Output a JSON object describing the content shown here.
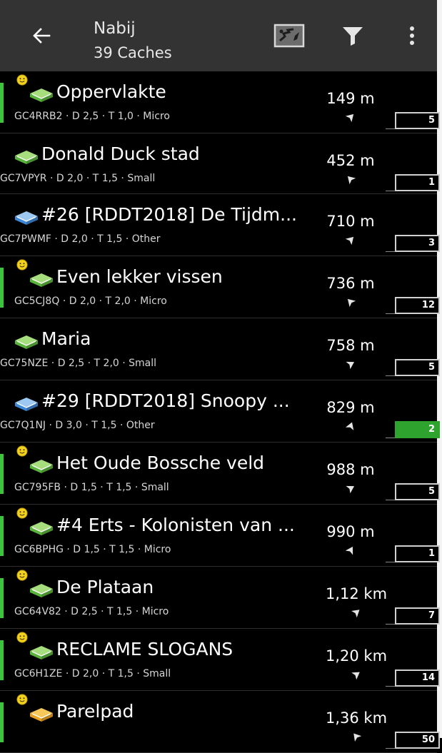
{
  "toolbar": {
    "title": "Nabij",
    "subtitle": "39 Caches"
  },
  "icons": {
    "back": "arrow-left-icon",
    "map": "map-icon",
    "filter": "filter-icon",
    "more": "more-vert-icon"
  },
  "colors": {
    "toolbar": "#333333",
    "found_bar": "#3cc43c",
    "highlight_count": "#2ea42e"
  },
  "caches": [
    {
      "name": "Oppervlakte",
      "meta": "GC4RRB2 · D 2,5 · T 1,0 · Micro",
      "distance": "149 m",
      "count": "5",
      "icon": "traditional-cache-icon",
      "smiley": true,
      "bar": true,
      "highlight": false,
      "bearing": 225
    },
    {
      "name": "Donald Duck stad",
      "meta": "GC7VPYR · D 2,0 · T 1,5 · Small",
      "distance": "452 m",
      "count": "1",
      "icon": "traditional-cache-icon",
      "smiley": false,
      "bar": false,
      "highlight": false,
      "bearing": 135
    },
    {
      "name": "#26 [RDDT2018] De Tijdm...",
      "meta": "GC7PWMF · D 2,0 · T 1,5 · Other",
      "distance": "710 m",
      "count": "3",
      "icon": "other-cache-icon",
      "smiley": false,
      "bar": false,
      "highlight": false,
      "bearing": 225
    },
    {
      "name": "Even lekker vissen",
      "meta": "GC5CJ8Q · D 2,0 · T 2,0 · Micro",
      "distance": "736 m",
      "count": "12",
      "icon": "traditional-cache-icon",
      "smiley": true,
      "bar": true,
      "highlight": false,
      "bearing": 135
    },
    {
      "name": "Maria",
      "meta": "GC75NZE · D 2,5 · T 2,0 · Small",
      "distance": "758 m",
      "count": "5",
      "icon": "traditional-cache-icon",
      "smiley": false,
      "bar": false,
      "highlight": false,
      "bearing": 240
    },
    {
      "name": "#29 [RDDT2018] Snoopy ...",
      "meta": "GC7Q1NJ · D 3,0 · T 1,5 · Other",
      "distance": "829 m",
      "count": "2",
      "icon": "other-cache-icon",
      "smiley": false,
      "bar": false,
      "highlight": true,
      "bearing": 200
    },
    {
      "name": "Het Oude Bossche veld",
      "meta": "GC795FB · D 1,5 · T 1,5 · Small",
      "distance": "988 m",
      "count": "5",
      "icon": "traditional-cache-icon",
      "smiley": true,
      "bar": true,
      "highlight": false,
      "bearing": 240
    },
    {
      "name": "#4 Erts - Kolonisten van ...",
      "meta": "GC6BPHG · D 1,5 · T 1,5 · Micro",
      "distance": "990 m",
      "count": "1",
      "icon": "traditional-cache-icon",
      "smiley": true,
      "bar": true,
      "highlight": false,
      "bearing": 210
    },
    {
      "name": "De Plataan",
      "meta": "GC64V82 · D 2,5 · T 1,5 · Micro",
      "distance": "1,12 km",
      "count": "7",
      "icon": "traditional-cache-icon",
      "smiley": true,
      "bar": true,
      "highlight": false,
      "bearing": 230
    },
    {
      "name": "RECLAME SLOGANS",
      "meta": "GC6H1ZE · D 2,0 · T 1,5 · Small",
      "distance": "1,20 km",
      "count": "14",
      "icon": "traditional-cache-icon",
      "smiley": true,
      "bar": true,
      "highlight": false,
      "bearing": 235
    },
    {
      "name": "Parelpad",
      "meta": "",
      "distance": "1,36 km",
      "count": "50",
      "icon": "multi-cache-icon",
      "smiley": true,
      "bar": true,
      "highlight": false,
      "bearing": 140
    }
  ]
}
